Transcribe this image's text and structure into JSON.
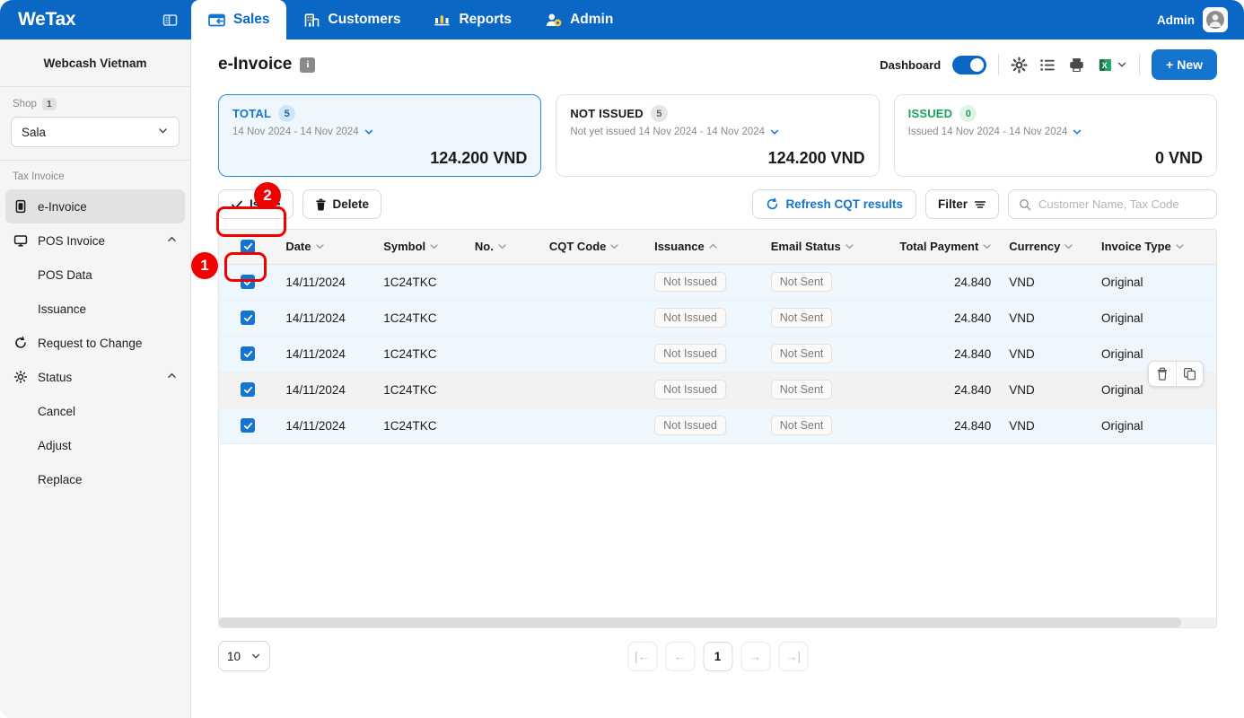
{
  "topbar": {
    "brand": "WeTax",
    "collapse_icon": "panel-toggle-icon",
    "tabs": [
      {
        "label": "Sales",
        "icon": "sales-icon",
        "active": true
      },
      {
        "label": "Customers",
        "icon": "customers-icon",
        "active": false
      },
      {
        "label": "Reports",
        "icon": "reports-icon",
        "active": false
      },
      {
        "label": "Admin",
        "icon": "admin-icon",
        "active": false
      }
    ],
    "user_label": "Admin",
    "avatar_icon": "user-avatar-icon"
  },
  "sidebar": {
    "org_name": "Webcash Vietnam",
    "shop_label": "Shop",
    "shop_count": "1",
    "shop_value": "Sala",
    "group_label": "Tax Invoice",
    "items": [
      {
        "label": "e-Invoice",
        "icon": "invoice-icon",
        "type": "item",
        "active": true
      },
      {
        "label": "POS Invoice",
        "icon": "monitor-icon",
        "type": "item",
        "active": false,
        "expandable": true
      },
      {
        "label": "POS Data",
        "type": "sub"
      },
      {
        "label": "Issuance",
        "type": "sub"
      },
      {
        "label": "Request to Change",
        "icon": "refresh-circle-icon",
        "type": "item",
        "active": false
      },
      {
        "label": "Status",
        "icon": "gear-icon",
        "type": "item",
        "active": false,
        "expandable": true
      },
      {
        "label": "Cancel",
        "type": "sub"
      },
      {
        "label": "Adjust",
        "type": "sub"
      },
      {
        "label": "Replace",
        "type": "sub"
      }
    ]
  },
  "header": {
    "title": "e-Invoice",
    "info_icon": "info-icon",
    "dashboard_label": "Dashboard",
    "dashboard_on": true,
    "gear_icon": "gear-icon",
    "list_icon": "list-icon",
    "print_icon": "print-icon",
    "excel_icon": "excel-icon",
    "new_label": "+ New"
  },
  "cards": [
    {
      "title": "TOTAL",
      "count": "5",
      "subtitle": "14 Nov 2024 - 14 Nov 2024",
      "amount": "124.200 VND",
      "selected": true
    },
    {
      "title": "NOT ISSUED",
      "count": "5",
      "subtitle": "Not yet issued 14 Nov 2024 - 14 Nov 2024",
      "amount": "124.200 VND",
      "selected": false
    },
    {
      "title": "ISSUED",
      "count": "0",
      "subtitle": "Issued 14 Nov 2024 - 14 Nov 2024",
      "amount": "0 VND",
      "selected": false
    }
  ],
  "toolbar": {
    "issue_label": "Issue",
    "delete_label": "Delete",
    "refresh_label": "Refresh CQT results",
    "filter_label": "Filter",
    "search_placeholder": "Customer Name, Tax Code",
    "search_value": ""
  },
  "table": {
    "columns": [
      {
        "label": "",
        "key": "check"
      },
      {
        "label": "Date",
        "sort": "down"
      },
      {
        "label": "Symbol",
        "sort": "down"
      },
      {
        "label": "No.",
        "sort": "down"
      },
      {
        "label": "CQT Code",
        "sort": "down"
      },
      {
        "label": "Issuance",
        "sort": "up"
      },
      {
        "label": "Email Status",
        "sort": "down"
      },
      {
        "label": "Total Payment",
        "sort": "down"
      },
      {
        "label": "Currency",
        "sort": "down"
      },
      {
        "label": "Invoice Type",
        "sort": "down"
      }
    ],
    "rows": [
      {
        "checked": true,
        "date": "14/11/2024",
        "symbol": "1C24TKC",
        "no": "",
        "cqt_code": "",
        "issuance": "Not Issued",
        "email_status": "Not Sent",
        "total_payment": "24.840",
        "currency": "VND",
        "invoice_type": "Original",
        "hovered": false
      },
      {
        "checked": true,
        "date": "14/11/2024",
        "symbol": "1C24TKC",
        "no": "",
        "cqt_code": "",
        "issuance": "Not Issued",
        "email_status": "Not Sent",
        "total_payment": "24.840",
        "currency": "VND",
        "invoice_type": "Original",
        "hovered": false
      },
      {
        "checked": true,
        "date": "14/11/2024",
        "symbol": "1C24TKC",
        "no": "",
        "cqt_code": "",
        "issuance": "Not Issued",
        "email_status": "Not Sent",
        "total_payment": "24.840",
        "currency": "VND",
        "invoice_type": "Original",
        "hovered": false
      },
      {
        "checked": true,
        "date": "14/11/2024",
        "symbol": "1C24TKC",
        "no": "",
        "cqt_code": "",
        "issuance": "Not Issued",
        "email_status": "Not Sent",
        "total_payment": "24.840",
        "currency": "VND",
        "invoice_type": "Original",
        "hovered": true
      },
      {
        "checked": true,
        "date": "14/11/2024",
        "symbol": "1C24TKC",
        "no": "",
        "cqt_code": "",
        "issuance": "Not Issued",
        "email_status": "Not Sent",
        "total_payment": "24.840",
        "currency": "VND",
        "invoice_type": "Original",
        "hovered": false
      }
    ],
    "row_actions": [
      {
        "icon": "trash-icon"
      },
      {
        "icon": "copy-icon"
      }
    ]
  },
  "footer": {
    "page_size": "10",
    "pager": [
      {
        "label": "|←",
        "name": "first-page"
      },
      {
        "label": "←",
        "name": "prev-page"
      },
      {
        "label": "1",
        "name": "page-1",
        "current": true
      },
      {
        "label": "→",
        "name": "next-page"
      },
      {
        "label": "→|",
        "name": "last-page"
      }
    ]
  },
  "annotations": [
    {
      "number": "1",
      "target": "select-all-checkbox"
    },
    {
      "number": "2",
      "target": "issue-button"
    }
  ],
  "colors": {
    "brand_blue": "#0b67c4",
    "accent_blue": "#1574cd",
    "green": "#17a45c",
    "annotation_red": "#f10000"
  }
}
